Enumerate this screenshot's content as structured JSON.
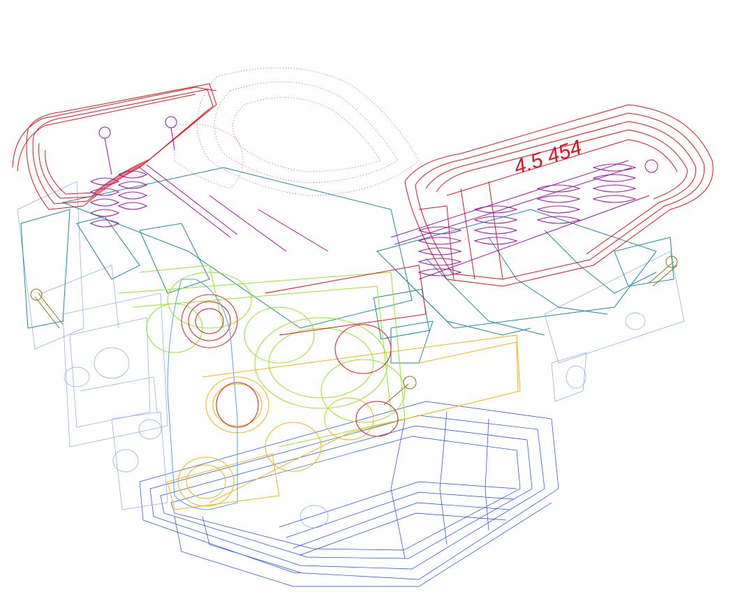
{
  "viewer": {
    "stamp_text": "4.5 454",
    "colors": {
      "valve_cover": "#e0141e",
      "intake": "#1a8a9e",
      "valvetrain": "#a012a8",
      "block": "#8aa4f2",
      "crank": "#8fe81c",
      "timing": "#f4b400",
      "oil_pan": "#1446ea",
      "chain": "#5aa0e6",
      "red_gear": "#e0141e",
      "bolt": "#8a7010",
      "cloud": "#e0141e"
    }
  }
}
